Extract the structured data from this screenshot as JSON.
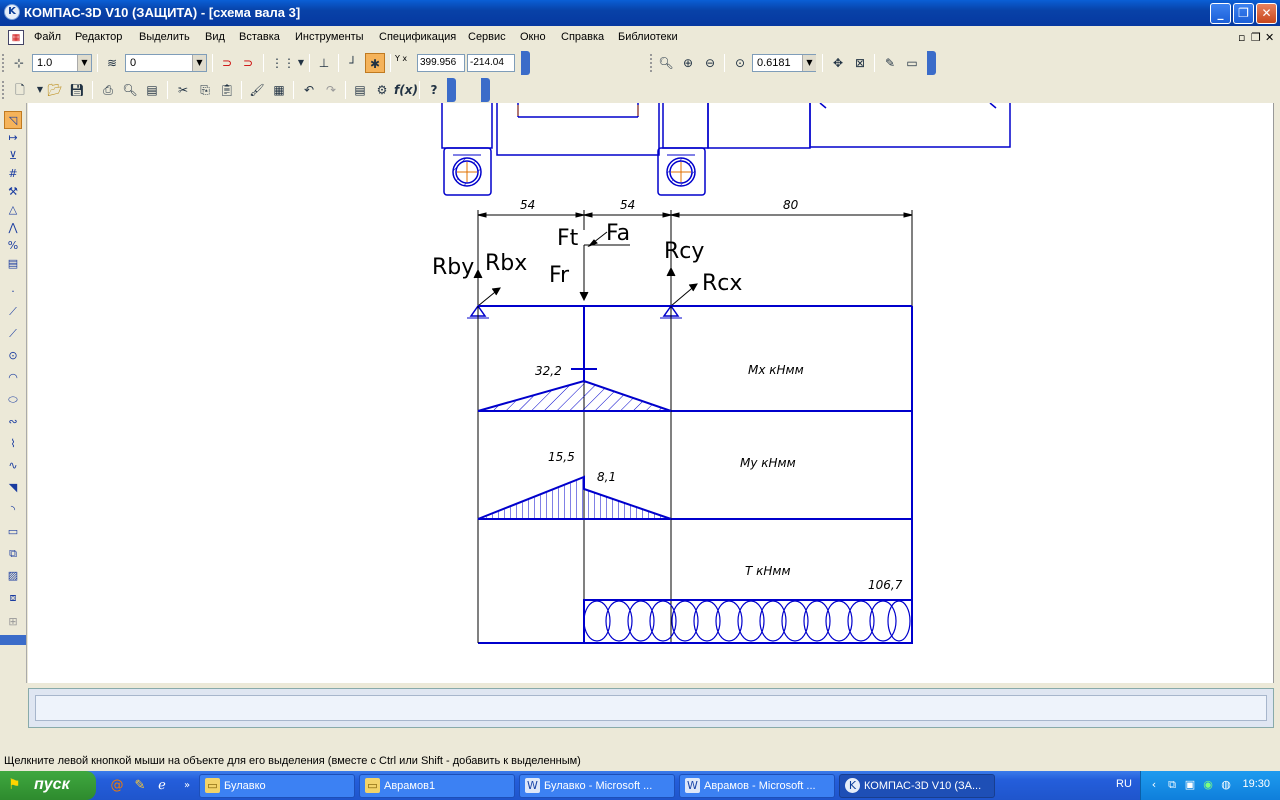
{
  "window": {
    "title": "КОМПАС-3D V10 (ЗАЩИТА) - [схема вала 3]",
    "app_icon": "K"
  },
  "menu": {
    "items": [
      "Файл",
      "Редактор",
      "Выделить",
      "Вид",
      "Вставка",
      "Инструменты",
      "Спецификация",
      "Сервис",
      "Окно",
      "Справка",
      "Библиотеки"
    ]
  },
  "toolbar_props": {
    "step_value": "1.0",
    "layer_value": "0",
    "coord_x": "399.956",
    "coord_y": "-214.04",
    "coord_label": "Y x"
  },
  "toolbar_view": {
    "zoom_value": "0.6181"
  },
  "drawing": {
    "dims": [
      "54",
      "54",
      "80"
    ],
    "forces": {
      "ft": "Ft",
      "fa": "Fa",
      "fr": "Fr",
      "rby": "Rby",
      "rbx": "Rbx",
      "rcy": "Rcy",
      "rcx": "Rcx"
    },
    "diagrams": {
      "mx_label": "Mx кНмм",
      "mx_value": "32,2",
      "my_label": "My кНмм",
      "my_value_1": "15,5",
      "my_value_2": "8,1",
      "t_label": "T кНмм",
      "t_value": "106,7"
    },
    "colors": {
      "line": "#0000cc",
      "accent": "#e07000"
    }
  },
  "status": {
    "hint": "Щелкните левой кнопкой мыши на объекте для его выделения (вместе с Ctrl или Shift - добавить к выделенным)"
  },
  "taskbar": {
    "start_label": "пуск",
    "tasks": [
      "Булавко",
      "Аврамов1",
      "Булавко - Microsoft ...",
      "Аврамов - Microsoft ...",
      "КОМПАС-3D V10 (ЗА..."
    ],
    "language": "RU",
    "clock": "19:30"
  }
}
